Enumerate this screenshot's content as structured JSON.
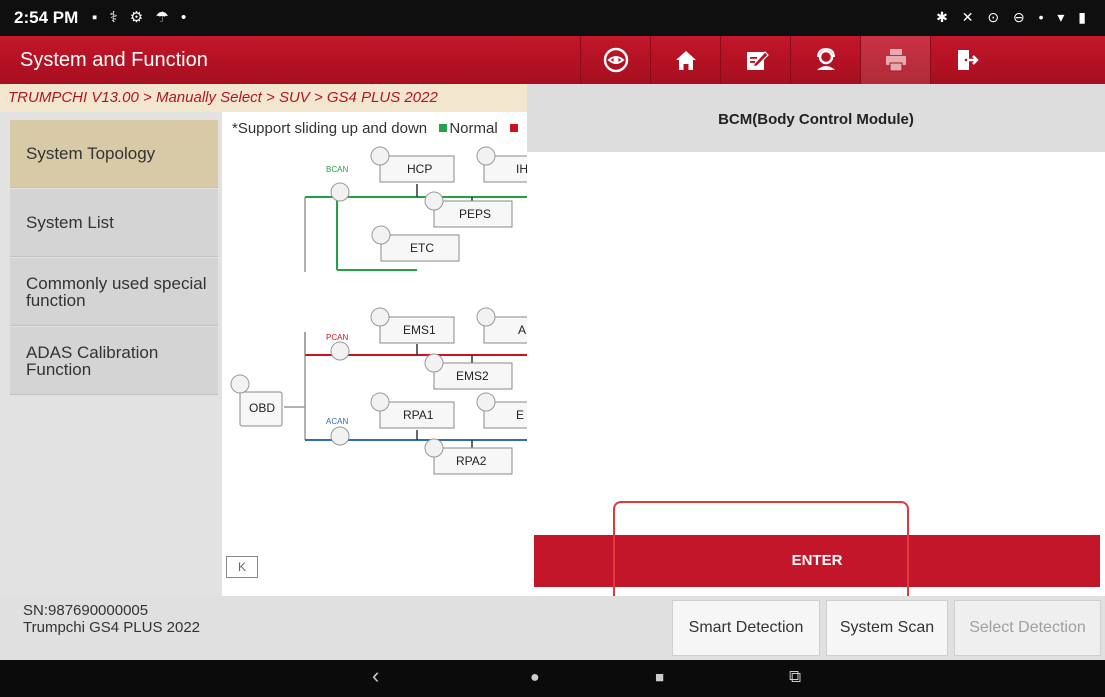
{
  "status_bar": {
    "time": "2:54 PM",
    "left_icons": "▪ ⚕ ⚙ ☂ •",
    "right_icons": "✱ ✕ ⊙ ⊖ • ▾ ▮"
  },
  "header": {
    "title": "System and Function",
    "toolbar": [
      {
        "name": "diagnose-icon",
        "highlighted": false
      },
      {
        "name": "home-icon",
        "highlighted": false
      },
      {
        "name": "edit-report-icon",
        "highlighted": false
      },
      {
        "name": "remote-support-icon",
        "highlighted": false
      },
      {
        "name": "print-icon",
        "highlighted": true
      },
      {
        "name": "exit-icon",
        "highlighted": false
      }
    ],
    "accent": "#c4162a"
  },
  "breadcrumb": "TRUMPCHI V13.00 > Manually Select > SUV > GS4 PLUS 2022",
  "sidebar": {
    "items": [
      {
        "label": "System Topology",
        "active": true
      },
      {
        "label": "System List",
        "active": false
      },
      {
        "label": "Commonly used special function",
        "active": false
      },
      {
        "label": "ADAS Calibration Function",
        "active": false
      }
    ],
    "collapse_label": "K"
  },
  "topology": {
    "note": "*Support sliding up and down",
    "legend_normal": "Normal",
    "legend_colors": {
      "normal": "#21a345",
      "fault": "#d0111f"
    },
    "buses": [
      {
        "label": "BCAN",
        "color": "#21a345"
      },
      {
        "label": "PCAN",
        "color": "#d0111f"
      },
      {
        "label": "ACAN",
        "color": "#2f6db5"
      }
    ],
    "nodes": [
      "OBD",
      "HCP",
      "IH",
      "PEPS",
      "ETC",
      "EMS1",
      "A",
      "EMS2",
      "RPA1",
      "E",
      "RPA2"
    ]
  },
  "module_panel": {
    "title": "BCM(Body Control Module)",
    "enter_label": "ENTER"
  },
  "footer": {
    "sn": "SN:987690000005",
    "vehicle": "Trumpchi GS4 PLUS 2022",
    "buttons": [
      {
        "label": "Smart Detection",
        "enabled": true
      },
      {
        "label": "System Scan",
        "enabled": true
      },
      {
        "label": "Select Detection",
        "enabled": false
      }
    ]
  },
  "nav": {
    "back": "‹",
    "home": "●",
    "recents": "■",
    "screenshot": "⧉"
  }
}
